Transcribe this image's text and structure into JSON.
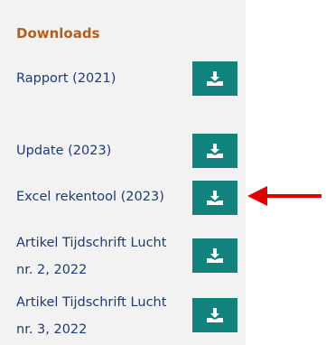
{
  "downloads": {
    "heading": "Downloads",
    "items": [
      {
        "line1": "Rapport (2021)",
        "line2": "",
        "icon": "download-icon"
      },
      {
        "line1": "Update (2023)",
        "line2": "",
        "icon": "download-icon"
      },
      {
        "line1": "Excel rekentool (2023)",
        "line2": "",
        "icon": "download-icon"
      },
      {
        "line1": "Artikel Tijdschrift Lucht",
        "line2": "nr. 2, 2022",
        "icon": "download-icon"
      },
      {
        "line1": "Artikel Tijdschrift Lucht",
        "line2": "nr. 3, 2022",
        "icon": "download-icon"
      }
    ]
  },
  "colors": {
    "button": "#11837c",
    "heading": "#b55e1c",
    "text": "#1f3b70",
    "annotation_arrow": "#e00000"
  }
}
